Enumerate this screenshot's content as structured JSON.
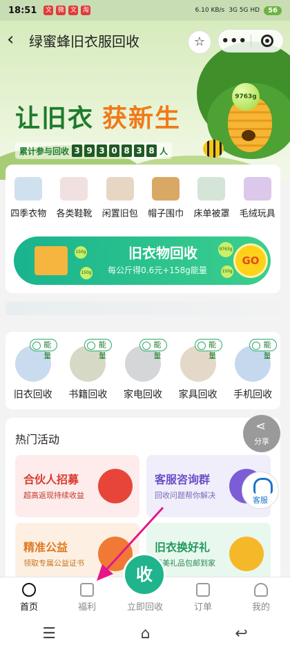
{
  "status": {
    "time": "18:51",
    "icons": [
      "文",
      "微",
      "文",
      "淘"
    ],
    "net": "6.10 KB/s",
    "signal": "3G 5G HD",
    "battery": "56"
  },
  "nav": {
    "back": "‹",
    "title": "绿蜜蜂旧衣服回收",
    "star": "☆",
    "more": "•••"
  },
  "hero": {
    "slogan_a": "让旧衣",
    "slogan_b": "获新生",
    "counter_label": "累计参与回收",
    "digits": [
      "3",
      "9",
      "3",
      "0",
      "8",
      "3",
      "8"
    ],
    "counter_unit": "人",
    "bubble": "9763g"
  },
  "categories": [
    {
      "label": "四季衣物",
      "color": "#cfe0ef"
    },
    {
      "label": "各类鞋靴",
      "color": "#f1e0e0"
    },
    {
      "label": "闲置旧包",
      "color": "#e8d6c4"
    },
    {
      "label": "帽子围巾",
      "color": "#d9a865"
    },
    {
      "label": "床单被罩",
      "color": "#d4e4d6"
    },
    {
      "label": "毛绒玩具",
      "color": "#dcc8ea"
    }
  ],
  "banner": {
    "title": "旧衣物回收",
    "subtitle": "每公斤得0.6元+158g能量",
    "go": "GO",
    "dots": [
      "150g",
      "150g",
      "9763g",
      "150g"
    ]
  },
  "services": {
    "energy": "能量",
    "items": [
      {
        "label": "旧衣回收",
        "color": "#c9dbef"
      },
      {
        "label": "书籍回收",
        "color": "#d6d9c6"
      },
      {
        "label": "家电回收",
        "color": "#d4d6d8"
      },
      {
        "label": "家具回收",
        "color": "#e4d8c8"
      },
      {
        "label": "手机回收",
        "color": "#c5d8ee"
      }
    ]
  },
  "hot": {
    "title": "热门活动",
    "acts": [
      {
        "title": "合伙人招募",
        "sub": "超高返现持续收益",
        "bg": "#fdeceb",
        "fg": "#d93a2f",
        "sfg": "#c0392b"
      },
      {
        "title": "客服咨询群",
        "sub": "回收问题帮你解决",
        "bg": "#f0eefb",
        "fg": "#6a4fc6",
        "sfg": "#7a6bb8"
      },
      {
        "title": "精准公益",
        "sub": "领取专属公益证书",
        "bg": "#fdf0e3",
        "fg": "#e0781f",
        "sfg": "#c8741e"
      },
      {
        "title": "旧衣换好礼",
        "sub": "精美礼品包邮到家",
        "bg": "#e9f8ef",
        "fg": "#1d9a5a",
        "sfg": "#2a8a55"
      }
    ]
  },
  "fab": {
    "share": "分享",
    "service": "客服"
  },
  "tabs": [
    {
      "label": "首页"
    },
    {
      "label": "福利"
    },
    {
      "label": "立即回收"
    },
    {
      "label": "订单"
    },
    {
      "label": "我的"
    }
  ],
  "center_btn": "收",
  "sysnav": [
    "☰",
    "⌂",
    "↩"
  ],
  "accent": "#1fb48b",
  "arrow_color": "#e6158a"
}
